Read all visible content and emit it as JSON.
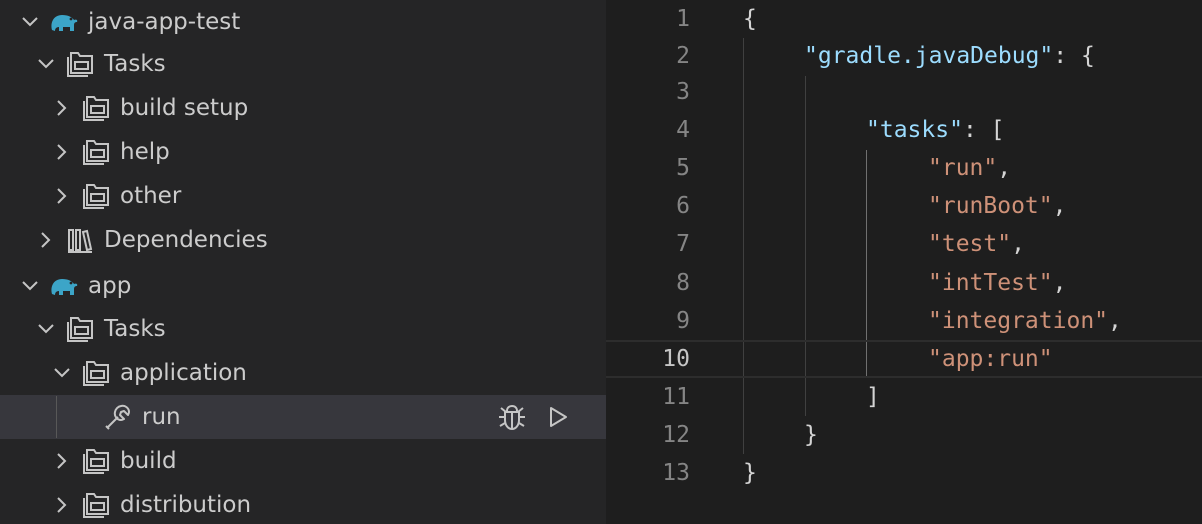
{
  "explorer": {
    "items": [
      {
        "label": "java-app-test",
        "icon": "gradle-elephant-icon",
        "twisty": "expanded"
      },
      {
        "label": "Tasks",
        "icon": "folder-library-icon",
        "twisty": "expanded"
      },
      {
        "label": "build setup",
        "icon": "folder-library-icon",
        "twisty": "collapsed"
      },
      {
        "label": "help",
        "icon": "folder-library-icon",
        "twisty": "collapsed"
      },
      {
        "label": "other",
        "icon": "folder-library-icon",
        "twisty": "collapsed"
      },
      {
        "label": "Dependencies",
        "icon": "library-icon",
        "twisty": "collapsed"
      },
      {
        "label": "app",
        "icon": "gradle-elephant-icon",
        "twisty": "expanded"
      },
      {
        "label": "Tasks",
        "icon": "folder-library-icon",
        "twisty": "expanded"
      },
      {
        "label": "application",
        "icon": "folder-library-icon",
        "twisty": "expanded"
      },
      {
        "label": "run",
        "icon": "wrench-icon",
        "twisty": "none",
        "selected": true
      },
      {
        "label": "build",
        "icon": "folder-library-icon",
        "twisty": "collapsed"
      },
      {
        "label": "distribution",
        "icon": "folder-library-icon",
        "twisty": "collapsed"
      }
    ],
    "run_actions": [
      "debug-icon",
      "play-icon"
    ]
  },
  "editor": {
    "current_line": 10,
    "lines": [
      {
        "n": "1",
        "text": "{"
      },
      {
        "n": "2",
        "key": "\"gradle.javaDebug\"",
        "rest": ": {"
      },
      {
        "n": "3",
        "text": ""
      },
      {
        "n": "4",
        "key": "\"tasks\"",
        "rest": ": ["
      },
      {
        "n": "5",
        "str": "\"run\"",
        "rest": ","
      },
      {
        "n": "6",
        "str": "\"runBoot\"",
        "rest": ","
      },
      {
        "n": "7",
        "str": "\"test\"",
        "rest": ","
      },
      {
        "n": "8",
        "str": "\"intTest\"",
        "rest": ","
      },
      {
        "n": "9",
        "str": "\"integration\"",
        "rest": ","
      },
      {
        "n": "10",
        "str": "\"app:run\"",
        "rest": ""
      },
      {
        "n": "11",
        "text": "]"
      },
      {
        "n": "12",
        "text": "}"
      },
      {
        "n": "13",
        "text": "}"
      }
    ]
  },
  "colors": {
    "sidebar_bg": "#252526",
    "editor_bg": "#1e1e1e",
    "selected_row": "#37373d",
    "json_key": "#9cdcfe",
    "json_string": "#ce9178",
    "gradle_icon": "#3ca5c8"
  }
}
